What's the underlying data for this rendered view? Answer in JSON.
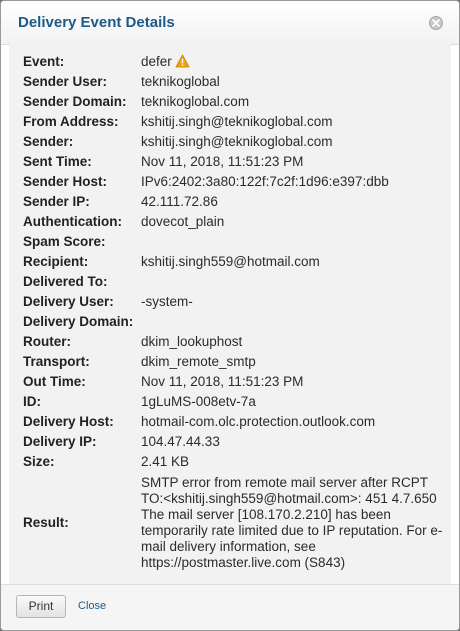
{
  "dialog": {
    "title": "Delivery Event Details",
    "close_icon": "close-icon"
  },
  "details": [
    {
      "label": "Event:",
      "value": "defer",
      "icon": "warning-icon",
      "icon_color": "#f0a30a"
    },
    {
      "label": "Sender User:",
      "value": "teknikoglobal"
    },
    {
      "label": "Sender Domain:",
      "value": "teknikoglobal.com"
    },
    {
      "label": "From Address:",
      "value": "kshitij.singh@teknikoglobal.com"
    },
    {
      "label": "Sender:",
      "value": "kshitij.singh@teknikoglobal.com"
    },
    {
      "label": "Sent Time:",
      "value": "Nov 11, 2018, 11:51:23 PM"
    },
    {
      "label": "Sender Host:",
      "value": "IPv6:2402:3a80:122f:7c2f:1d96:e397:dbb"
    },
    {
      "label": "Sender IP:",
      "value": "42.111.72.86"
    },
    {
      "label": "Authentication:",
      "value": "dovecot_plain"
    },
    {
      "label": "Spam Score:",
      "value": ""
    },
    {
      "label": "Recipient:",
      "value": "kshitij.singh559@hotmail.com"
    },
    {
      "label": "Delivered To:",
      "value": ""
    },
    {
      "label": "Delivery User:",
      "value": "-system-"
    },
    {
      "label": "Delivery Domain:",
      "value": ""
    },
    {
      "label": "Router:",
      "value": "dkim_lookuphost"
    },
    {
      "label": "Transport:",
      "value": "dkim_remote_smtp"
    },
    {
      "label": "Out Time:",
      "value": "Nov 11, 2018, 11:51:23 PM"
    },
    {
      "label": "ID:",
      "value": "1gLuMS-008etv-7a"
    },
    {
      "label": "Delivery Host:",
      "value": "hotmail-com.olc.protection.outlook.com"
    },
    {
      "label": "Delivery IP:",
      "value": "104.47.44.33"
    },
    {
      "label": "Size:",
      "value": "2.41 KB"
    },
    {
      "label": "Result:",
      "value": "SMTP error from remote mail server after RCPT TO:<kshitij.singh559@hotmail.com>: 451 4.7.650 The mail server [108.170.2.210] has been temporarily rate limited due to IP reputation. For e-mail delivery information, see https://postmaster.live.com (S843)"
    }
  ],
  "footer": {
    "print_label": "Print",
    "close_label": "Close"
  }
}
